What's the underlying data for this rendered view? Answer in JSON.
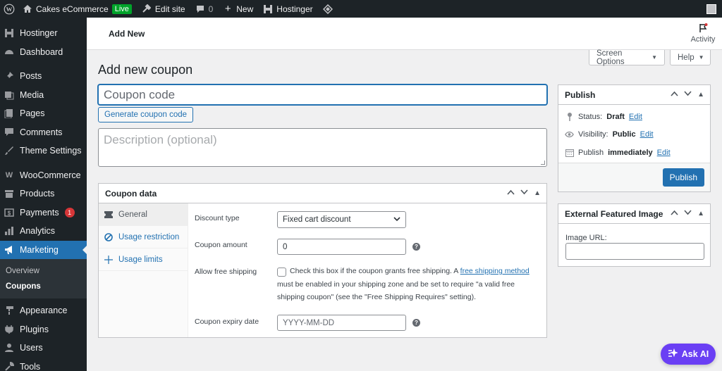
{
  "admin_bar": {
    "site_name": "Cakes eCommerce",
    "live_badge": "Live",
    "edit_site": "Edit site",
    "comments_count": "0",
    "new_label": "New",
    "hostinger_label": "Hostinger"
  },
  "sidebar": {
    "items": [
      {
        "label": "Hostinger",
        "icon": "hostinger-icon"
      },
      {
        "label": "Dashboard",
        "icon": "dashboard-icon"
      },
      {
        "label": "Posts",
        "icon": "pin-icon"
      },
      {
        "label": "Media",
        "icon": "media-icon"
      },
      {
        "label": "Pages",
        "icon": "pages-icon"
      },
      {
        "label": "Comments",
        "icon": "comment-icon"
      },
      {
        "label": "Theme Settings",
        "icon": "brush-icon"
      },
      {
        "label": "WooCommerce",
        "icon": "woo-icon"
      },
      {
        "label": "Products",
        "icon": "archive-icon"
      },
      {
        "label": "Payments",
        "icon": "dollar-icon",
        "badge": "1"
      },
      {
        "label": "Analytics",
        "icon": "bar-chart-icon"
      },
      {
        "label": "Marketing",
        "icon": "megaphone-icon"
      },
      {
        "label": "Appearance",
        "icon": "paint-icon"
      },
      {
        "label": "Plugins",
        "icon": "plugin-icon"
      },
      {
        "label": "Users",
        "icon": "user-icon"
      },
      {
        "label": "Tools",
        "icon": "wrench-icon"
      }
    ],
    "submenu": {
      "overview": "Overview",
      "coupons": "Coupons"
    }
  },
  "topbar": {
    "title": "Add New",
    "activity": "Activity"
  },
  "screen_options": {
    "label": "Screen Options",
    "help": "Help"
  },
  "page": {
    "title": "Add new coupon",
    "coupon_code_placeholder": "Coupon code",
    "generate_button": "Generate coupon code",
    "description_placeholder": "Description (optional)"
  },
  "coupon_data": {
    "title": "Coupon data",
    "tabs": [
      "General",
      "Usage restriction",
      "Usage limits"
    ],
    "discount_type_label": "Discount type",
    "discount_type_value": "Fixed cart discount",
    "coupon_amount_label": "Coupon amount",
    "coupon_amount_value": "0",
    "free_shipping_label": "Allow free shipping",
    "free_shipping_text_before": "Check this box if the coupon grants free shipping. A ",
    "free_shipping_link": "free shipping method",
    "free_shipping_text_after": " must be enabled in your shipping zone and be set to require \"a valid free shipping coupon\" (see the \"Free Shipping Requires\" setting).",
    "expiry_label": "Coupon expiry date",
    "expiry_placeholder": "YYYY-MM-DD"
  },
  "publish": {
    "title": "Publish",
    "status_label": "Status:",
    "status_value": "Draft",
    "visibility_label": "Visibility:",
    "visibility_value": "Public",
    "publish_label": "Publish",
    "publish_value": "immediately",
    "edit": "Edit",
    "button": "Publish"
  },
  "external_image": {
    "title": "External Featured Image",
    "url_label": "Image URL:"
  },
  "ask_ai": "Ask AI",
  "colors": {
    "accent": "#2271b1",
    "sidebar": "#1d2327",
    "ai": "#6a3ff4",
    "live": "#00a32a"
  }
}
